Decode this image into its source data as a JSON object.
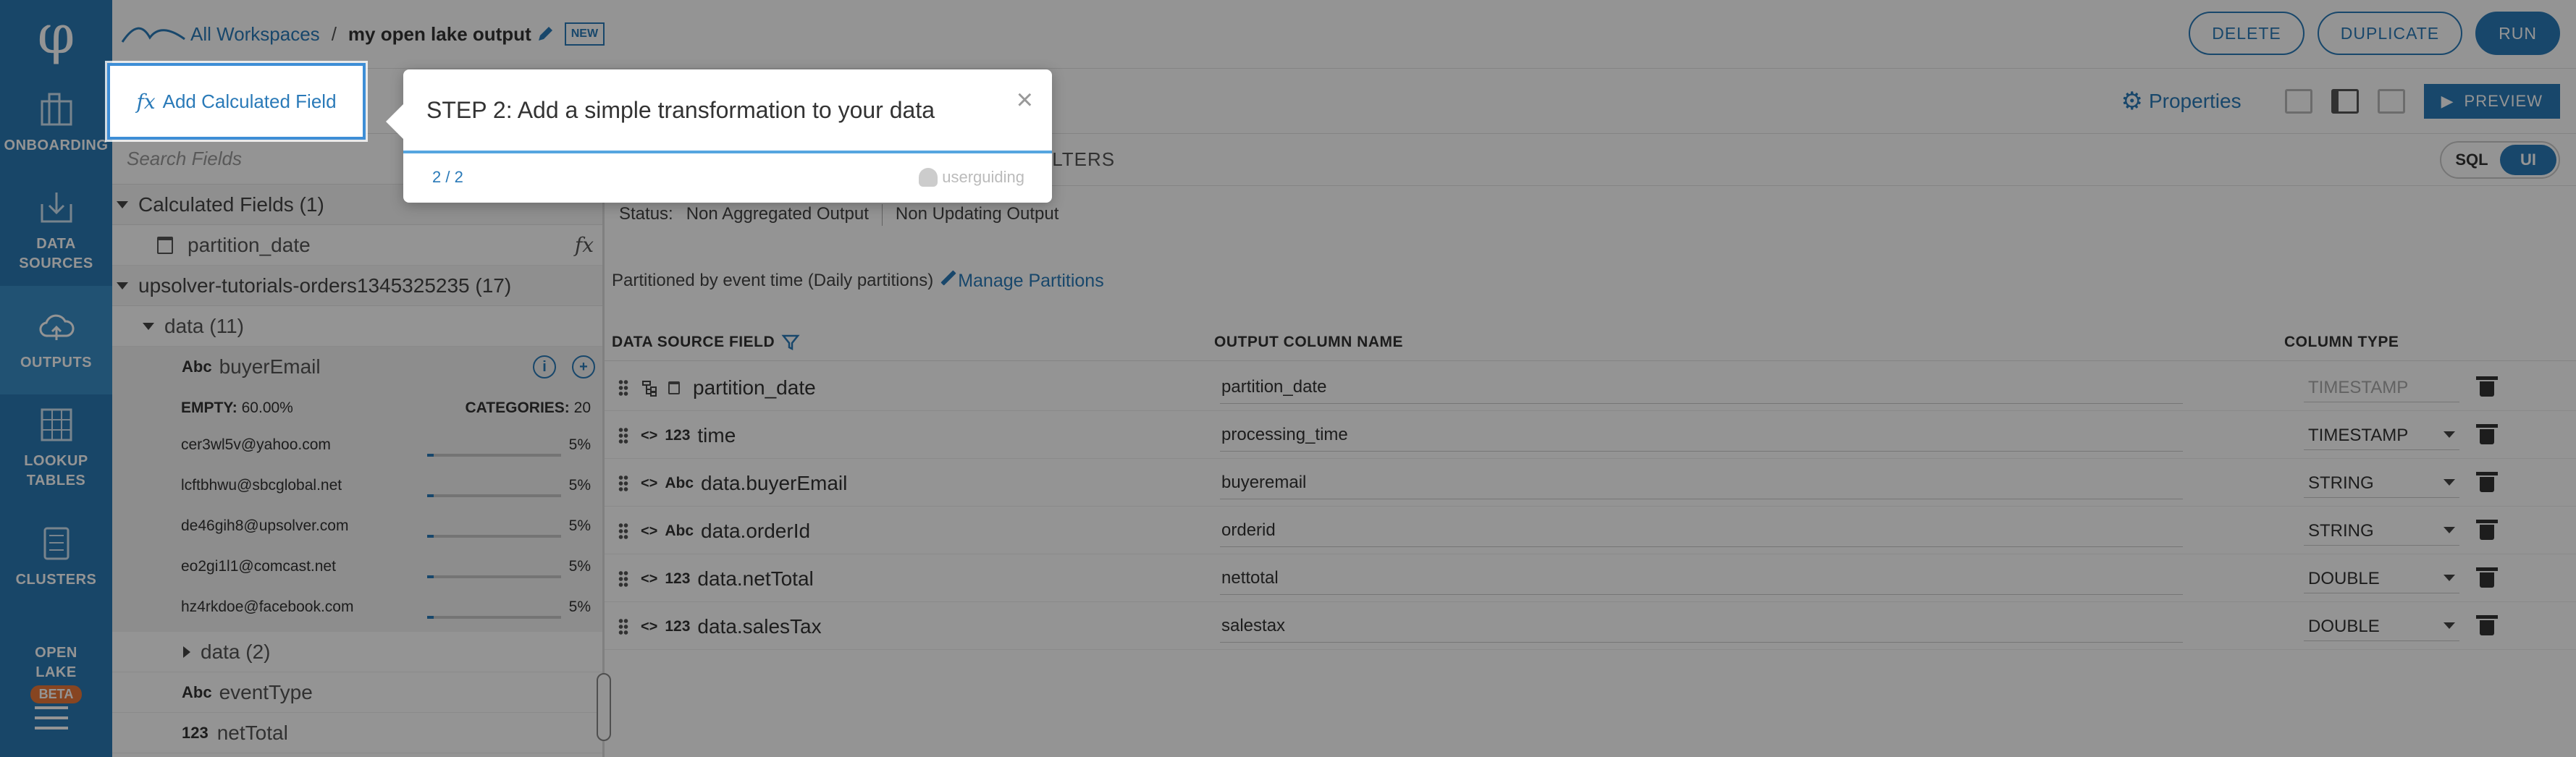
{
  "nav": {
    "items": [
      {
        "label": "ONBOARDING",
        "icon": "onboarding-icon"
      },
      {
        "label": "DATA\nSOURCES",
        "icon": "data-sources-icon"
      },
      {
        "label": "OUTPUTS",
        "icon": "outputs-cloud-icon"
      },
      {
        "label": "LOOKUP\nTABLES",
        "icon": "lookup-tables-icon"
      },
      {
        "label": "CLUSTERS",
        "icon": "clusters-icon"
      },
      {
        "label": "OPEN\nLAKE",
        "icon": "open-lake-icon",
        "badge": "BETA"
      }
    ]
  },
  "breadcrumb": {
    "workspaces": "All Workspaces",
    "separator": "/",
    "name": "my open lake output",
    "badge": "NEW"
  },
  "topbar": {
    "delete": "DELETE",
    "duplicate": "DUPLICATE",
    "run": "RUN"
  },
  "toolbar": {
    "add_calc": "Add Calculated Field",
    "properties": "Properties",
    "preview": "PREVIEW"
  },
  "fields": {
    "search_placeholder": "Search Fields",
    "calc_group": "Calculated Fields (1)",
    "calc_field": "partition_date",
    "source_group": "upsolver-tutorials-orders1345325235 (17)",
    "data_group": "data (11)",
    "buyer": {
      "type": "Abc",
      "name": "buyerEmail"
    },
    "stats": {
      "empty_label": "EMPTY:",
      "empty_value": "60.00%",
      "cat_label": "CATEGORIES:",
      "cat_value": "20",
      "values": [
        {
          "v": "cer3wl5v@yahoo.com",
          "p": "5%"
        },
        {
          "v": "lcftbhwu@sbcglobal.net",
          "p": "5%"
        },
        {
          "v": "de46gih8@upsolver.com",
          "p": "5%"
        },
        {
          "v": "eo2gi1l1@comcast.net",
          "p": "5%"
        },
        {
          "v": "hz4rkdoe@facebook.com",
          "p": "5%"
        }
      ]
    },
    "sub_group": "data (2)",
    "event": {
      "type": "Abc",
      "name": "eventType"
    },
    "net": {
      "type": "123",
      "name": "netTotal"
    }
  },
  "main": {
    "filters_tab": "ILTERS",
    "toggle": {
      "sql": "SQL",
      "ui": "UI"
    },
    "status_label": "Status:",
    "status_1": "Non Aggregated Output",
    "status_2": "Non Updating Output",
    "partition_text": "Partitioned by event time (Daily partitions)",
    "manage_partitions": "Manage Partitions"
  },
  "table": {
    "headers": {
      "source": "DATA SOURCE FIELD",
      "output": "OUTPUT COLUMN NAME",
      "type": "COLUMN TYPE"
    },
    "rows": [
      {
        "src": "partition_date",
        "out": "partition_date",
        "type": "TIMESTAMP"
      },
      {
        "tag": "123",
        "src": "time",
        "out": "processing_time",
        "type": "TIMESTAMP"
      },
      {
        "tag": "Abc",
        "src": "data.buyerEmail",
        "out": "buyeremail",
        "type": "STRING"
      },
      {
        "tag": "Abc",
        "src": "data.orderId",
        "out": "orderid",
        "type": "STRING"
      },
      {
        "tag": "123",
        "src": "data.netTotal",
        "out": "nettotal",
        "type": "DOUBLE"
      },
      {
        "tag": "123",
        "src": "data.salesTax",
        "out": "salestax",
        "type": "DOUBLE"
      }
    ]
  },
  "popup": {
    "title": "STEP 2: Add a simple transformation to your data",
    "step": "2 / 2",
    "brand": "userguiding"
  }
}
